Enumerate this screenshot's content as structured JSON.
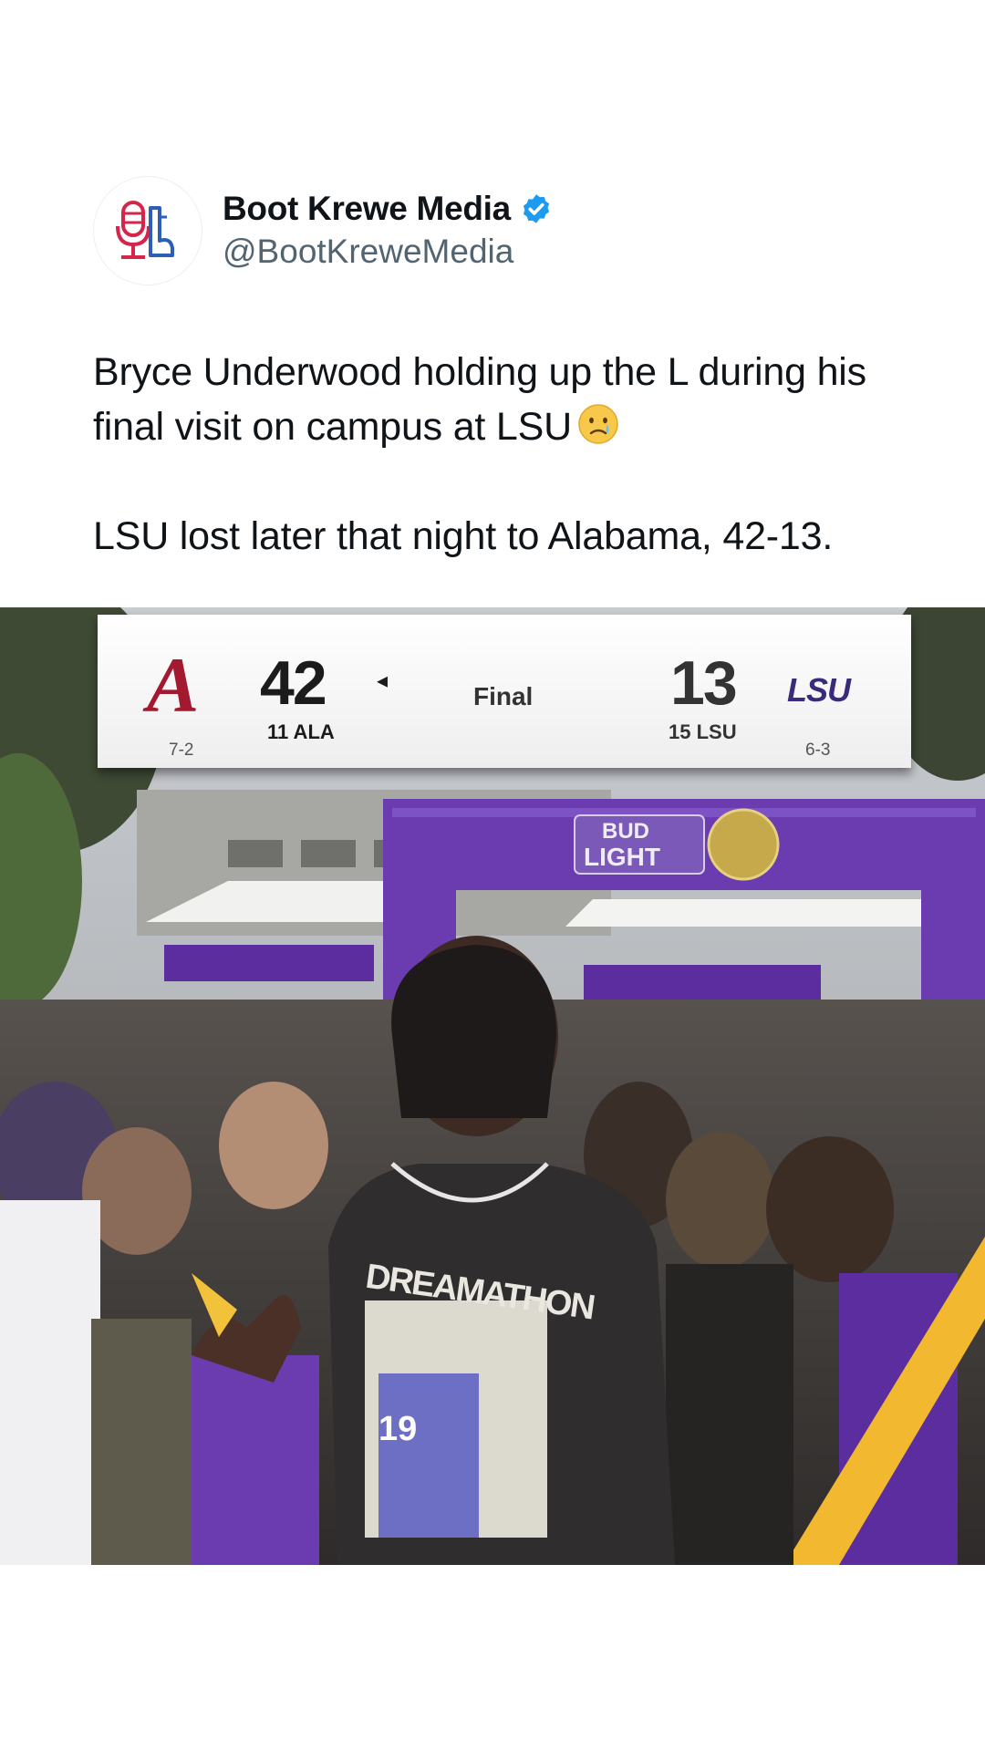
{
  "author": {
    "display_name": "Boot Krewe Media",
    "handle": "@BootKreweMedia",
    "verified_icon": "verified-badge-icon",
    "avatar_icon": "microphone-logo-icon"
  },
  "tweet": {
    "line_1": "Bryce Underwood holding up the L during his final visit on campus at LSU",
    "line_2": "LSU lost later that night to Alabama, 42-13."
  },
  "scoreboard": {
    "away_logo": "A",
    "away_score": "42",
    "away_rank_team": "11 ALA",
    "away_record": "7-2",
    "possession_indicator": "◂",
    "status": "Final",
    "home_score": "13",
    "home_rank_team": "15 LSU",
    "home_record": "6-3",
    "home_logo": "LSU"
  },
  "photo": {
    "sign_text_1": "BUD",
    "sign_text_2": "LIGHT",
    "shirt_text": "DREAMATHON",
    "shirt_number": "19"
  },
  "colors": {
    "verified_blue": "#1d9bf0",
    "alabama_crimson": "#a21930",
    "lsu_purple": "#5b2d9e",
    "lsu_gold": "#f2b830"
  }
}
